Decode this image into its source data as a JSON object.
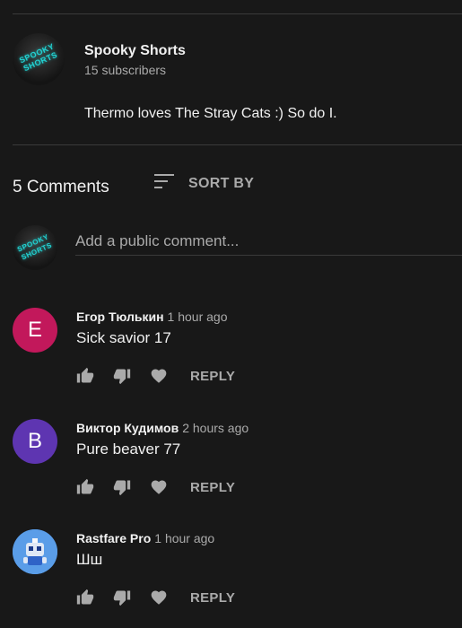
{
  "channel": {
    "name": "Spooky Shorts",
    "subscribers": "15 subscribers",
    "avatar_text": "SPOOKY SHORTS",
    "description": "Thermo loves The Stray Cats :) So do I."
  },
  "comments_header": {
    "count": "5 Comments",
    "sort_label": "SORT BY"
  },
  "comment_box": {
    "placeholder": "Add a public comment...",
    "avatar_text": "SPOOKY SHORTS"
  },
  "comments": [
    {
      "initial": "E",
      "avatar_color": "#c2185b",
      "author": "Егор Тюлькин",
      "time": "1 hour ago",
      "text": "Sick savior 17",
      "reply_label": "REPLY"
    },
    {
      "initial": "B",
      "avatar_color": "#5e35b1",
      "author": "Виктор Кудимов",
      "time": "2 hours ago",
      "text": "Pure beaver 77",
      "reply_label": "REPLY"
    },
    {
      "initial": "",
      "avatar_color": "#4a8ee0",
      "author": "Rastfare Pro",
      "time": "1 hour ago",
      "text": "Шш",
      "reply_label": "REPLY"
    }
  ]
}
